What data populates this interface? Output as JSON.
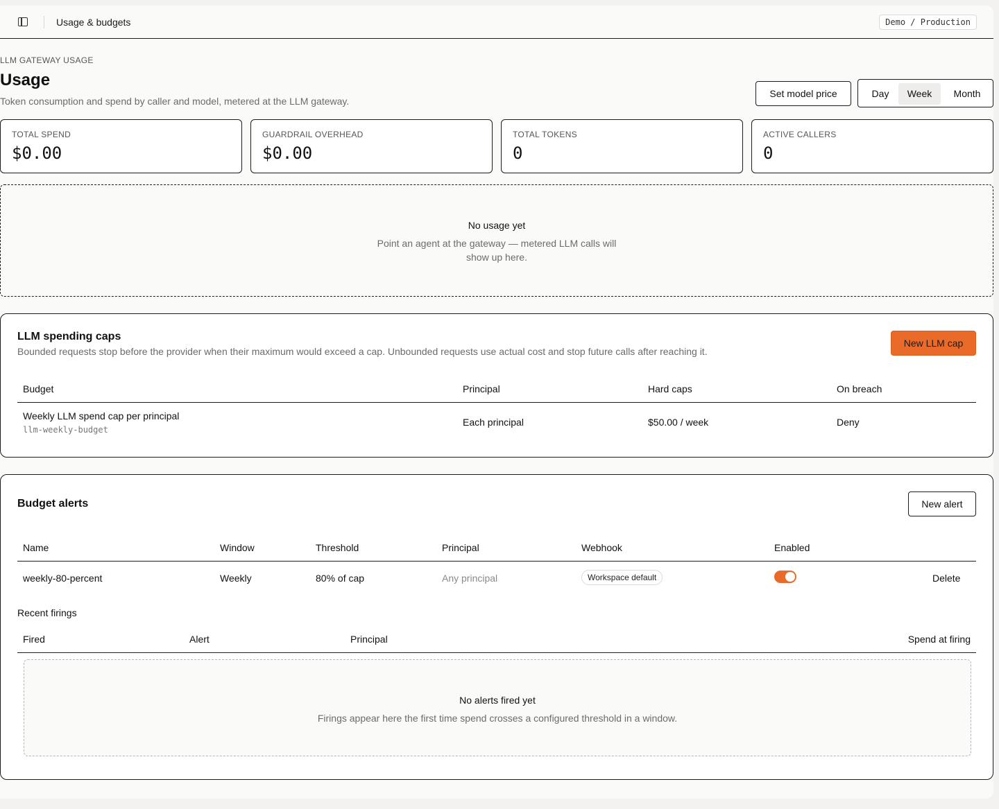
{
  "header": {
    "page_title": "Usage & budgets",
    "environment": "Demo / Production"
  },
  "intro": {
    "eyebrow": "LLM GATEWAY USAGE",
    "title": "Usage",
    "subtitle": "Token consumption and spend by caller and model, metered at the LLM gateway.",
    "set_price_label": "Set model price",
    "range_options": [
      "Day",
      "Week",
      "Month"
    ],
    "range_selected": "Week"
  },
  "stats": [
    {
      "label": "TOTAL SPEND",
      "value": "$0.00"
    },
    {
      "label": "GUARDRAIL OVERHEAD",
      "value": "$0.00"
    },
    {
      "label": "TOTAL TOKENS",
      "value": "0"
    },
    {
      "label": "ACTIVE CALLERS",
      "value": "0"
    }
  ],
  "empty_usage": {
    "title": "No usage yet",
    "line1": "Point an agent at the gateway — metered LLM calls will",
    "line2": "show up here."
  },
  "caps": {
    "title": "LLM spending caps",
    "description": "Bounded requests stop before the provider when their maximum would exceed a cap. Unbounded requests use actual cost and stop future calls after reaching it.",
    "new_label": "New LLM cap",
    "columns": [
      "Budget",
      "Principal",
      "Hard caps",
      "On breach"
    ],
    "rows": [
      {
        "name": "Weekly LLM spend cap per principal",
        "slug": "llm-weekly-budget",
        "principal": "Each principal",
        "hard_caps": "$50.00 / week",
        "on_breach": "Deny"
      }
    ]
  },
  "alerts": {
    "title": "Budget alerts",
    "new_label": "New alert",
    "columns": [
      "Name",
      "Window",
      "Threshold",
      "Principal",
      "Webhook",
      "Enabled"
    ],
    "rows": [
      {
        "name": "weekly-80-percent",
        "window": "Weekly",
        "threshold": "80% of cap",
        "principal": "Any principal",
        "webhook": "Workspace default",
        "enabled": true,
        "delete_label": "Delete"
      }
    ],
    "firings": {
      "title": "Recent firings",
      "columns": [
        "Fired",
        "Alert",
        "Principal",
        "Spend at firing"
      ],
      "empty_title": "No alerts fired yet",
      "empty_body": "Firings appear here the first time spend crosses a configured threshold in a window."
    }
  },
  "colors": {
    "accent": "#ea6a2a",
    "border": "#1b1b1b",
    "muted_text": "#6b6b6b"
  }
}
